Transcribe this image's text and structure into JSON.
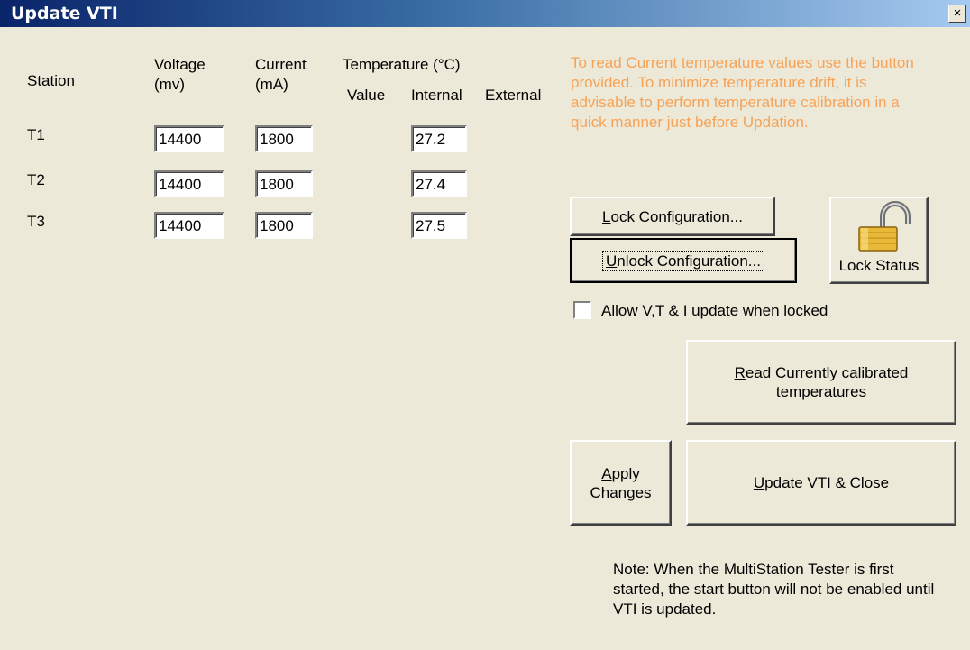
{
  "window": {
    "title": "Update VTI",
    "close_glyph": "×"
  },
  "headers": {
    "station": "Station",
    "voltage_line1": "Voltage",
    "voltage_line2": "(mv)",
    "current_line1": "Current",
    "current_line2": "(mA)",
    "temperature": "Temperature (°C)",
    "value": "Value",
    "internal": "Internal",
    "external": "External"
  },
  "stations": [
    {
      "name": "T1",
      "voltage": "14400",
      "current": "1800",
      "internal": "27.2"
    },
    {
      "name": "T2",
      "voltage": "14400",
      "current": "1800",
      "internal": "27.4"
    },
    {
      "name": "T3",
      "voltage": "14400",
      "current": "1800",
      "internal": "27.5"
    }
  ],
  "info_note": "To read Current temperature values use the button provided. To minimize temperature drift, it is advisable to perform temperature calibration in a quick manner just before Updation.",
  "buttons": {
    "lock_config": {
      "accel": "L",
      "rest": "ock Configuration..."
    },
    "unlock_config": {
      "accel": "U",
      "rest": "nlock Configuration..."
    },
    "lock_status": "Lock Status",
    "read_temps": {
      "accel": "R",
      "rest_line1": "ead Currently calibrated",
      "line2": "temperatures"
    },
    "apply": {
      "accel": "A",
      "rest_line1": "pply",
      "line2": "Changes"
    },
    "update_close": {
      "accel": "U",
      "rest": "pdate VTI & Close"
    }
  },
  "checkbox": {
    "label": "Allow V,T & I update when locked",
    "checked": false
  },
  "icons": {
    "lock_status": "padlock-unlocked-icon"
  },
  "bottom_note": "Note: When the MultiStation Tester is first started, the start button will not be enabled until VTI is updated."
}
